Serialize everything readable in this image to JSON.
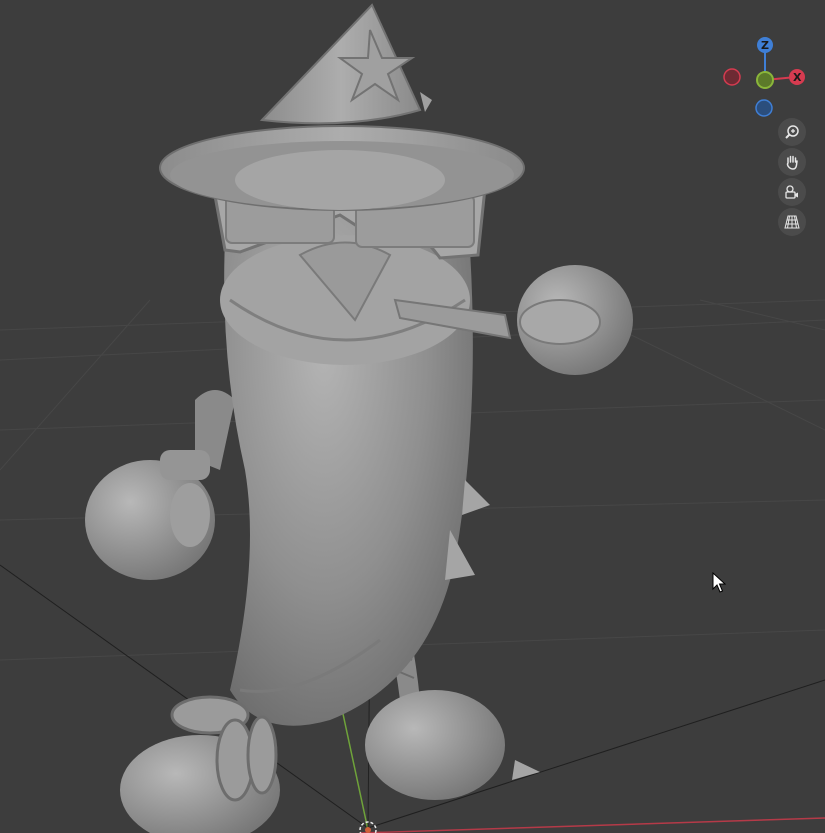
{
  "viewport": {
    "background_color": "#3d3d3d",
    "grid_color": "#4a4a4a",
    "x_axis_color": "#b53a48",
    "y_axis_color": "#6fa33a",
    "model_color": "#9c9c9c",
    "object": "stylized-pepper-wizard-sculpt"
  },
  "gizmo": {
    "z_label": "Z",
    "x_label": "X",
    "z_color": "#3f7fd6",
    "x_color": "#d63b50",
    "y_color": "#8ab63a"
  },
  "nav": {
    "zoom_icon": "zoom-icon",
    "pan_icon": "hand-icon",
    "camera_icon": "camera-icon",
    "perspective_icon": "grid-icon"
  }
}
